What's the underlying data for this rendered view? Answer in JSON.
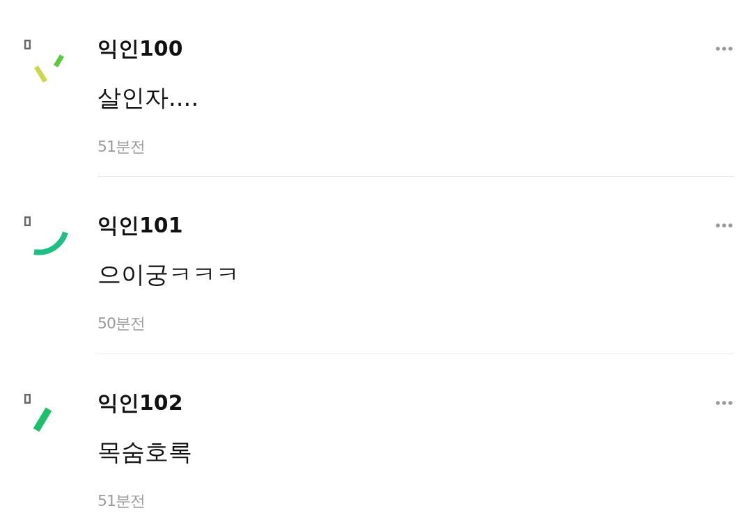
{
  "comments": [
    {
      "avatar": {
        "kind": "dashes"
      },
      "author": "익인100",
      "text": "살인자....",
      "time": "51분전"
    },
    {
      "avatar": {
        "kind": "arc"
      },
      "author": "익인101",
      "text": "으이궁ㅋㅋㅋ",
      "time": "50분전"
    },
    {
      "avatar": {
        "kind": "bar"
      },
      "author": "익인102",
      "text": "목숨호록",
      "time": "51분전"
    }
  ]
}
